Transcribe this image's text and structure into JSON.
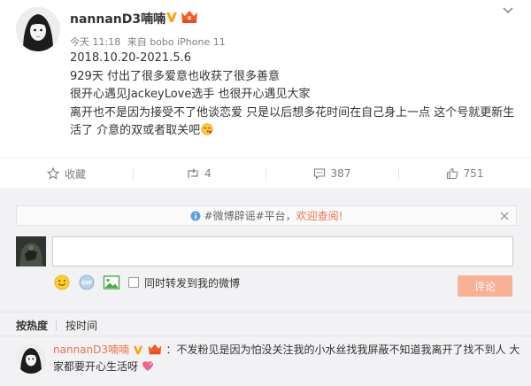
{
  "post": {
    "username": "nannanD3喃喃",
    "time": "今天 11:18",
    "source": "来自 bobo iPhone 11",
    "lines": [
      "2018.10.20-2021.5.6",
      "929天 付出了很多爱意也收获了很多善意",
      "很开心遇见JackeyLove选手 也很开心遇见大家",
      "离开也不是因为接受不了他谈恋爱 只是以后想多花时间在自己身上一点 这个号就更新生活了 介意的双或者取关吧"
    ]
  },
  "actions": {
    "favorite": "收藏",
    "repost": "4",
    "comment": "387",
    "like": "751"
  },
  "comments_section": {
    "notice_prefix": "#微博辟谣#平台，",
    "notice_link": "欢迎查阅!",
    "input_placeholder": "",
    "forward_label": "同时转发到我的微博",
    "submit_label": "评论",
    "sort_hot": "按热度",
    "sort_time": "按时间",
    "comment": {
      "user": "nannanD3喃喃",
      "text": "：不发粉见是因为怕没关注我的小水丝找我屏蔽不知道我离开了找不到人 大家都要开心生活呀"
    }
  },
  "colors": {
    "accent": "#eb7350",
    "verify": "#ffa00a",
    "submit_disabled": "#f8b096",
    "comment_bg": "#f2f2f5"
  }
}
